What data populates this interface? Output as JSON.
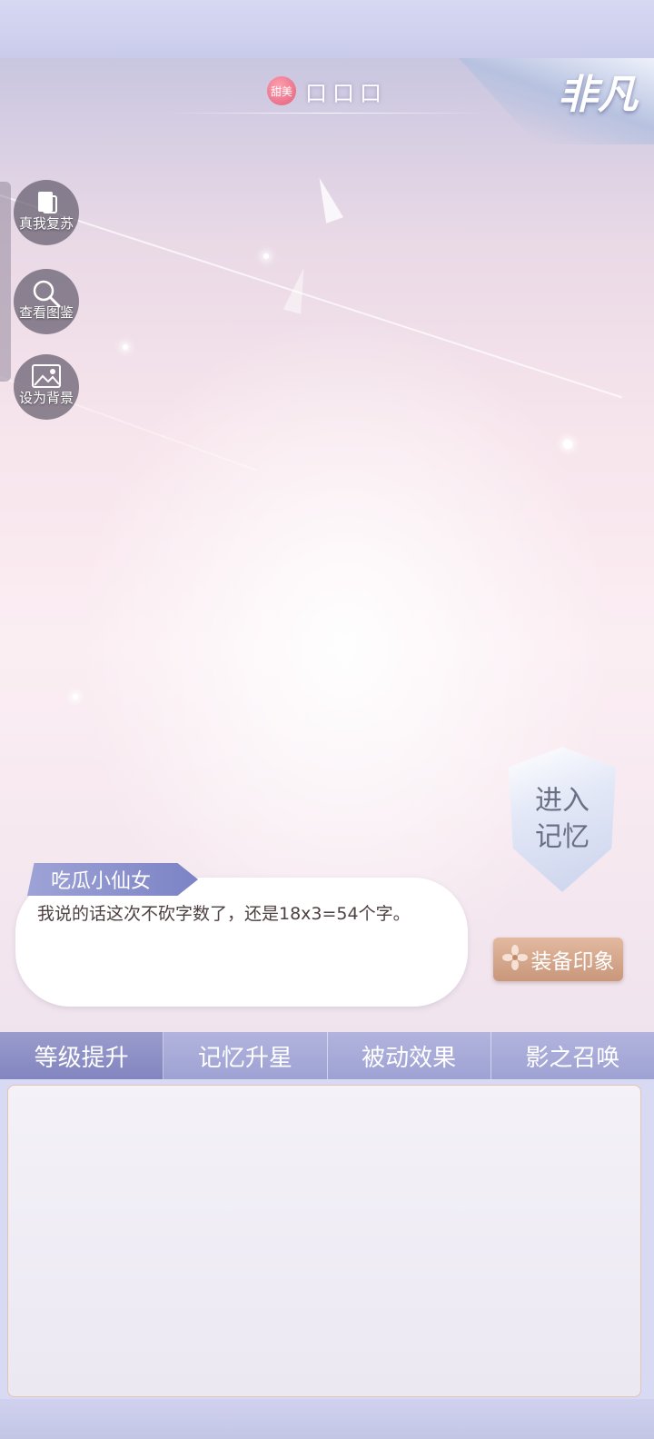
{
  "header": {
    "mood_badge": "甜美",
    "character_name": "口口口",
    "rarity_label": "非凡"
  },
  "side_buttons": [
    {
      "label": "真我复苏",
      "icon": "card-swap-icon"
    },
    {
      "label": "查看图鉴",
      "icon": "magnifier-icon"
    },
    {
      "label": "设为背景",
      "icon": "picture-icon"
    }
  ],
  "enter_memory": {
    "line1": "进入",
    "line2": "记忆"
  },
  "equip_button": {
    "label": "装备印象",
    "icon": "flower-icon"
  },
  "dialogue": {
    "speaker": "吃瓜小仙女",
    "text": "我说的话这次不砍字数了，还是18x3=54个字。"
  },
  "tabs": [
    {
      "label": "等级提升",
      "active": true
    },
    {
      "label": "记忆升星",
      "active": false
    },
    {
      "label": "被动效果",
      "active": false
    },
    {
      "label": "影之召唤",
      "active": false
    }
  ],
  "colors": {
    "tab_bar": "#a8abd8",
    "equip_button": "#d4a78c",
    "speaker_tag": "#8d93cf"
  }
}
